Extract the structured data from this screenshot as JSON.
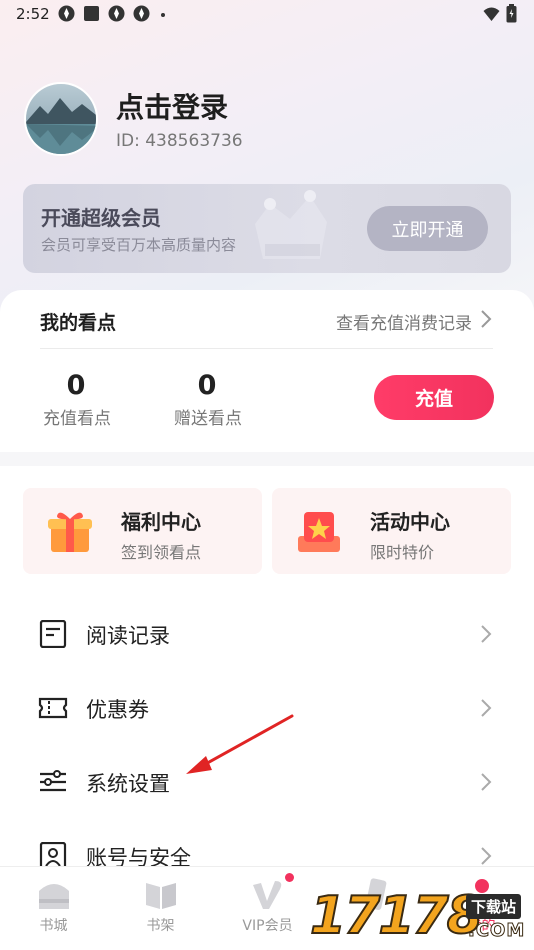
{
  "status_bar": {
    "time": "2:52"
  },
  "profile": {
    "login_text": "点击登录",
    "user_id": "ID: 438563736"
  },
  "vip": {
    "title": "开通超级会员",
    "subtitle": "会员可享受百万本高质量内容",
    "button": "立即开通"
  },
  "points": {
    "title": "我的看点",
    "record_link": "查看充值消费记录",
    "recharged_value": "0",
    "recharged_label": "充值看点",
    "gift_value": "0",
    "gift_label": "赠送看点",
    "recharge_button": "充值"
  },
  "features": [
    {
      "title": "福利中心",
      "subtitle": "签到领看点",
      "icon": "gift-icon"
    },
    {
      "title": "活动中心",
      "subtitle": "限时特价",
      "icon": "activity-icon"
    }
  ],
  "menu": [
    {
      "label": "阅读记录",
      "icon": "reading-record-icon"
    },
    {
      "label": "优惠券",
      "icon": "coupon-icon"
    },
    {
      "label": "系统设置",
      "icon": "settings-icon"
    },
    {
      "label": "账号与安全",
      "icon": "account-security-icon"
    }
  ],
  "bottom_nav": [
    {
      "label": "书城",
      "icon": "bookstore-icon"
    },
    {
      "label": "书架",
      "icon": "bookshelf-icon"
    },
    {
      "label": "VIP会员",
      "icon": "vip-icon"
    },
    {
      "label": "",
      "icon": "category-icon"
    },
    {
      "label": "我的",
      "icon": "profile-icon",
      "active": true
    }
  ],
  "watermark": {
    "digits": "17178",
    "badge": "下载站",
    "domain": ".COM"
  },
  "colors": {
    "accent": "#f2325e",
    "vip_button": "#b4b4c4",
    "feature_bg": "#fdf3f3"
  }
}
